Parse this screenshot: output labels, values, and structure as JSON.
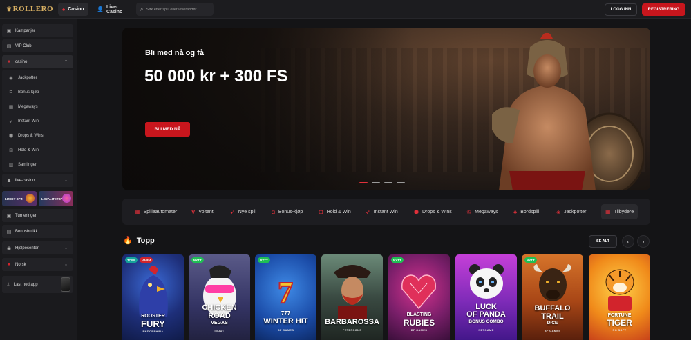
{
  "brand": {
    "logo_text": "ROLLERO",
    "accent": "#c8161d"
  },
  "topbar": {
    "tab_casino": "Casino",
    "tab_live": "Live-Casino",
    "search_placeholder": "Søk etter spill eller leverandør",
    "login": "LOGG INN",
    "register": "REGISTRERING"
  },
  "sidebar": {
    "kampanjer": "Kampanjer",
    "vip": "VIP Club",
    "casino": "casino",
    "casino_items": [
      "Jackpotter",
      "Bonus-kjøp",
      "Megaways",
      "Instant Win",
      "Drops & Wins",
      "Hold & Win",
      "Samlinger"
    ],
    "live_casino": "live-casino",
    "promo_lucky": "LUCKY SPIN",
    "promo_loyalty": "LOJALITETSPR",
    "turneringer": "Turneringer",
    "bonusbutikk": "Bonusbutikk",
    "hjelpesenter": "Hjelpesenter",
    "language": "Norsk",
    "download_app": "Last ned app"
  },
  "hero": {
    "eyebrow": "Bli med nå og få",
    "title": "50 000 kr + 300 FS",
    "cta": "BLI MED NÅ",
    "slides": 4,
    "active_slide": 1
  },
  "categories": [
    "Spilleautomater",
    "Voltent",
    "Nye spill",
    "Bonus-kjøp",
    "Hold & Win",
    "Instant Win",
    "Drops & Wins",
    "Megaways",
    "Bordspill",
    "Jackpotter",
    "Tilbydere"
  ],
  "top_section": {
    "title": "Topp",
    "see_all": "SE ALT",
    "games": [
      {
        "name_line1": "ROOSTER",
        "name_line2": "FURY",
        "provider": "ENDORPHINA",
        "badges": [
          "TOPP",
          "VARM"
        ]
      },
      {
        "name_line1": "CHICKEN",
        "name_line2": "ROAD",
        "name_line3": "VEGAS",
        "provider": "INOUT",
        "badges": [
          "NYTT"
        ]
      },
      {
        "name_line1": "777",
        "name_line2": "WINTER HIT",
        "provider": "BF GAMES",
        "badges": [
          "NYTT"
        ]
      },
      {
        "name_line1": "BARBAROSSA",
        "provider": "PETERSONS",
        "badges": []
      },
      {
        "name_line1": "BLASTING",
        "name_line2": "RUBIES",
        "provider": "BF GAMES",
        "badges": [
          "NYTT"
        ]
      },
      {
        "name_line1": "LUCK",
        "name_line2": "OF PANDA",
        "name_line3": "BONUS COMBO",
        "provider": "NETGAME",
        "badges": []
      },
      {
        "name_line1": "BUFFALO",
        "name_line2": "TRAIL",
        "name_line3": "DICE",
        "provider": "BF GAMES",
        "badges": [
          "NYTT"
        ]
      },
      {
        "name_line1": "FORTUNE",
        "name_line2": "TIGER",
        "provider": "PG SOFT",
        "badges": []
      }
    ]
  }
}
